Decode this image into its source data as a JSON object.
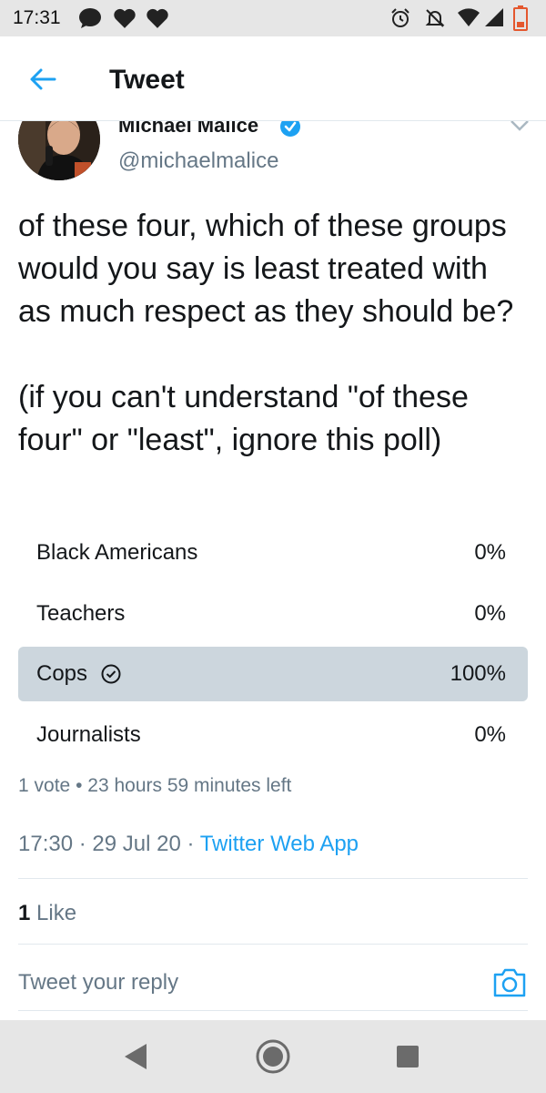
{
  "status_bar": {
    "time": "17:31",
    "left_icons": [
      "messenger-icon",
      "heart-icon",
      "heart-icon"
    ],
    "right_icons": [
      "alarm-icon",
      "notifications-off-icon",
      "wifi-icon",
      "signal-icon",
      "battery-low-icon"
    ]
  },
  "header": {
    "title": "Tweet"
  },
  "tweet": {
    "author_name": "Michael Malice",
    "author_handle": "@michaelmalice",
    "text": "of these four, which of these groups would you say is least treated with as much respect as they should be?\n\n(if you can't understand \"of these four\" or \"least\", ignore this poll)"
  },
  "poll": {
    "options": [
      {
        "label": "Black Americans",
        "percent": "0%"
      },
      {
        "label": "Teachers",
        "percent": "0%"
      },
      {
        "label": "Cops",
        "percent": "100%"
      },
      {
        "label": "Journalists",
        "percent": "0%"
      }
    ],
    "selected_index": 2,
    "votes": "1 vote",
    "separator": "•",
    "time_left": "23 hours 59 minutes left"
  },
  "meta": {
    "time": "17:30",
    "dot": "·",
    "date": "29 Jul 20",
    "source": "Twitter Web App"
  },
  "engagement": {
    "like_count": "1",
    "like_label": "Like"
  },
  "reply_bar": {
    "placeholder": "Tweet your reply"
  },
  "colors": {
    "accent": "#1da1f2",
    "poll_highlight": "#ccd6dd",
    "secondary_text": "#657786"
  }
}
